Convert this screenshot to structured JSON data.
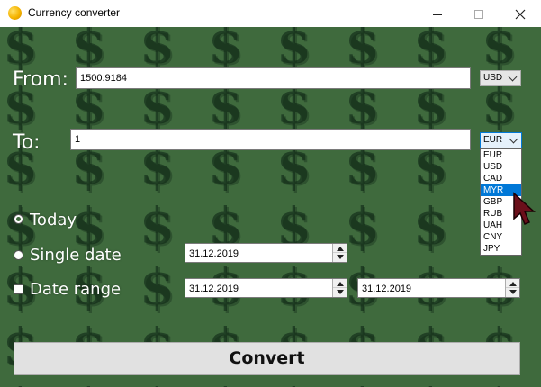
{
  "window": {
    "title": "Currency converter",
    "icon": "coin-icon",
    "controls": [
      "minimize-icon",
      "maximize-icon",
      "close-icon"
    ]
  },
  "colors": {
    "background": "#3f6a3d",
    "dollar_pattern": "#1f3f22",
    "selection": "#0078d7"
  },
  "from": {
    "label": "From:",
    "amount": "1500.9184",
    "currency": "USD"
  },
  "to": {
    "label": "To:",
    "amount": "1",
    "currency": "EUR",
    "dropdown_open": true,
    "options": [
      "EUR",
      "USD",
      "CAD",
      "MYR",
      "GBP",
      "RUB",
      "UAH",
      "CNY",
      "JPY"
    ],
    "highlighted_option": "MYR"
  },
  "date_mode": {
    "today_label": "Today",
    "single_date_label": "Single date",
    "date_range_label": "Date range",
    "selected": "today"
  },
  "dates": {
    "single": "31.12.2019",
    "range_start": "31.12.2019",
    "range_end": "31.12.2019"
  },
  "convert_button": {
    "label": "Convert"
  }
}
